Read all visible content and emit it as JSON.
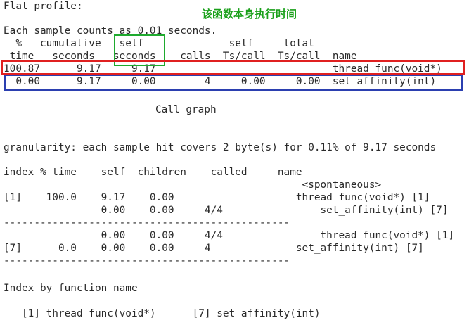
{
  "annotation": {
    "text": "该函数本身执行时间",
    "color": "#1aa01a"
  },
  "flat_profile": {
    "title": "Flat profile:",
    "sample_note": "Each sample counts as 0.01 seconds.",
    "header_line1": "  %   cumulative   self              self     total",
    "header_line2": " time   seconds   seconds    calls  Ts/call  Ts/call  name",
    "rows": [
      "100.87      9.17     9.17                             thread_func(void*)",
      "  0.00      9.17     0.00        4     0.00     0.00  set_affinity(int)"
    ]
  },
  "call_graph": {
    "title": "Call graph",
    "granularity": "granularity: each sample hit covers 2 byte(s) for 0.11% of 9.17 seconds",
    "header": "index % time    self  children    called     name",
    "lines": [
      "                                                 <spontaneous>",
      "[1]    100.0    9.17    0.00                    thread_func(void*) [1]",
      "                0.00    0.00     4/4                set_affinity(int) [7]",
      "-----------------------------------------------",
      "                0.00    0.00     4/4                thread_func(void*) [1]",
      "[7]      0.0    0.00    0.00     4              set_affinity(int) [7]",
      "-----------------------------------------------"
    ]
  },
  "index_by_function": {
    "title": "Index by function name",
    "entries": "   [1] thread_func(void*)      [7] set_affinity(int)"
  },
  "highlight_colors": {
    "red": "#e02020",
    "blue": "#2b3fb0",
    "green": "#1eaa2e"
  }
}
